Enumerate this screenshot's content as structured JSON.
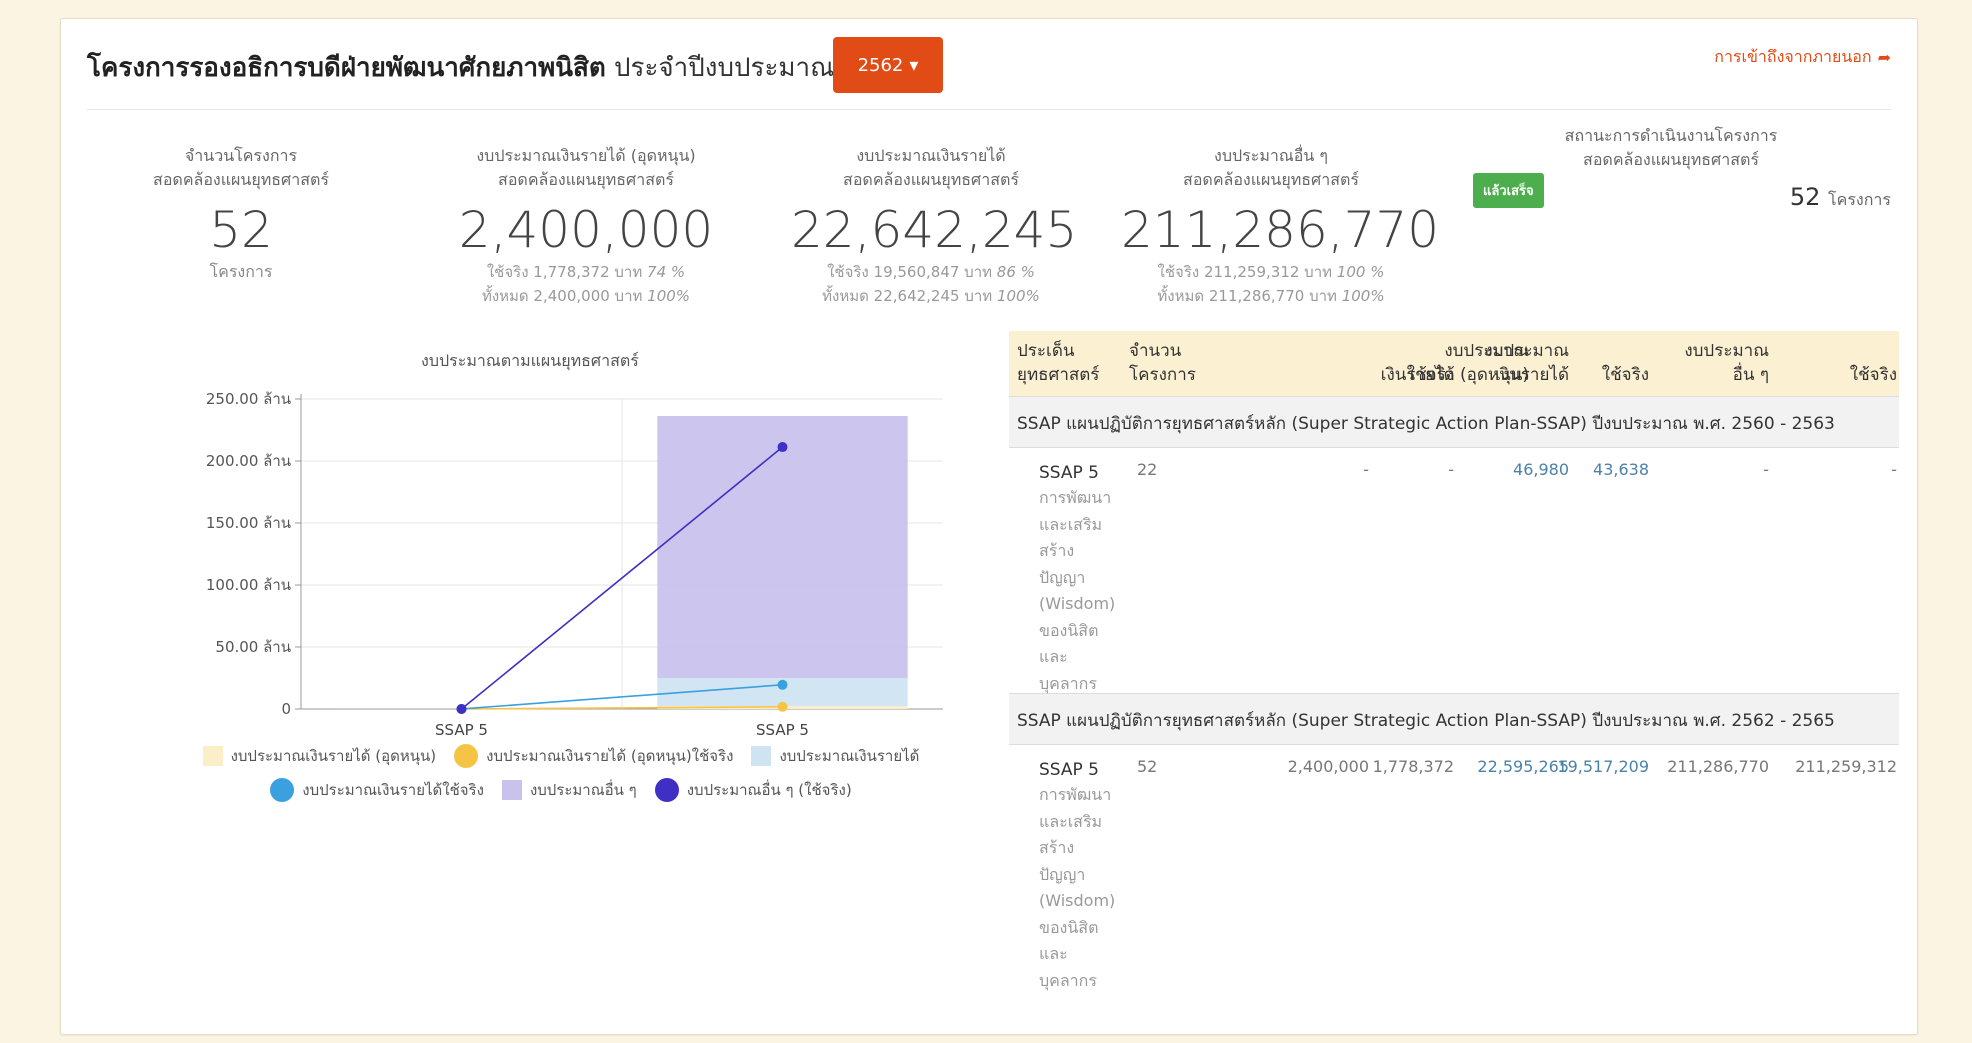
{
  "header": {
    "title_bold": "โครงการรองอธิการบดีฝ่ายพัฒนาศักยภาพนิสิต",
    "title_rest": "ประจำปีงบประมาณ",
    "year": "2562",
    "external_link": "การเข้าถึงจากภายนอก"
  },
  "stats": {
    "projects": {
      "label1": "จำนวนโครงการ",
      "label2": "สอดคล้องแผนยุทธศาสตร์",
      "value": "52",
      "unit": "โครงการ"
    },
    "subsidy": {
      "label1": "งบประมาณเงินรายได้ (อุดหนุน)",
      "label2": "สอดคล้องแผนยุทธศาสตร์",
      "value": "2,400,000",
      "used": "ใช้จริง 1,778,372 บาท",
      "used_pct": "74 %",
      "total": "ทั้งหมด 2,400,000 บาท",
      "total_pct": "100%"
    },
    "income": {
      "label1": "งบประมาณเงินรายได้",
      "label2": "สอดคล้องแผนยุทธศาสตร์",
      "value": "22,642,245",
      "used": "ใช้จริง 19,560,847 บาท",
      "used_pct": "86 %",
      "total": "ทั้งหมด 22,642,245 บาท",
      "total_pct": "100%"
    },
    "other": {
      "label1": "งบประมาณอื่น ๆ",
      "label2": "สอดคล้องแผนยุทธศาสตร์",
      "value": "211,286,770",
      "used": "ใช้จริง 211,259,312 บาท",
      "used_pct": "100 %",
      "total": "ทั้งหมด 211,286,770 บาท",
      "total_pct": "100%"
    },
    "status": {
      "label1": "สถานะการดำเนินงานโครงการ",
      "label2": "สอดคล้องแผนยุทธศาสตร์",
      "badge": "แล้วเสร็จ",
      "count": "52",
      "unit": "โครงการ"
    }
  },
  "chart_title": "งบประมาณตามแผนยุทธศาสตร์",
  "chart_data": {
    "type": "bar",
    "categories": [
      "SSAP 5",
      "SSAP 5"
    ],
    "ylim": [
      0,
      250000000
    ],
    "yticks": [
      0,
      50000000,
      100000000,
      150000000,
      200000000,
      250000000
    ],
    "ytick_labels": [
      "0",
      "50.00 ล้าน",
      "100.00 ล้าน",
      "150.00 ล้าน",
      "200.00 ล้าน",
      "250.00 ล้าน"
    ],
    "series": [
      {
        "name": "งบประมาณเงินรายได้ (อุดหนุน)",
        "kind": "bar",
        "color": "#fbeec9",
        "values": [
          0,
          2400000
        ]
      },
      {
        "name": "งบประมาณเงินรายได้ (อุดหนุน)ใช้จริง",
        "kind": "line",
        "color": "#f6c445",
        "values": [
          0,
          1778372
        ]
      },
      {
        "name": "งบประมาณเงินรายได้",
        "kind": "bar",
        "color": "#cfe4f1",
        "values": [
          46980,
          22595265
        ]
      },
      {
        "name": "งบประมาณเงินรายได้ใช้จริง",
        "kind": "line",
        "color": "#3aa0e0",
        "values": [
          43638,
          19517209
        ]
      },
      {
        "name": "งบประมาณอื่น ๆ",
        "kind": "bar",
        "color": "#c9c2ec",
        "values": [
          0,
          211286770
        ]
      },
      {
        "name": "งบประมาณอื่น ๆ (ใช้จริง)",
        "kind": "line",
        "color": "#3f2fc4",
        "values": [
          0,
          211259312
        ]
      }
    ]
  },
  "table": {
    "headers": [
      {
        "l1": "ประเด็น",
        "l2": "ยุทธศาสตร์"
      },
      {
        "l1": "จำนวน",
        "l2": "โครงการ"
      },
      {
        "l1": "งบประมาณ",
        "l2": "เงินรายได้ (อุดหนุน)"
      },
      {
        "l1": "",
        "l2": "ใช้จริง"
      },
      {
        "l1": "งบประมาณ",
        "l2": "เงินรายได้"
      },
      {
        "l1": "",
        "l2": "ใช้จริง"
      },
      {
        "l1": "งบประมาณ",
        "l2": "อื่น ๆ"
      },
      {
        "l1": "",
        "l2": "ใช้จริง"
      }
    ],
    "groups": [
      {
        "title": "SSAP แผนปฏิบัติการยุทธศาสตร์หลัก (Super Strategic Action Plan-SSAP) ปีงบประมาณ พ.ศ. 2560 - 2563",
        "row": {
          "code": "SSAP 5",
          "desc": [
            "การพัฒนา",
            "และเสริม",
            "สร้าง",
            "ปัญญา",
            "(Wisdom)",
            "ของนิสิต",
            "และ",
            "บุคลากร"
          ],
          "count": "22",
          "subsidy": "-",
          "subsidy_used": "-",
          "income": "46,980",
          "income_used": "43,638",
          "other": "-",
          "other_used": "-"
        }
      },
      {
        "title": "SSAP แผนปฏิบัติการยุทธศาสตร์หลัก (Super Strategic Action Plan-SSAP) ปีงบประมาณ พ.ศ. 2562 - 2565",
        "row": {
          "code": "SSAP 5",
          "desc": [
            "การพัฒนา",
            "และเสริม",
            "สร้าง",
            "ปัญญา",
            "(Wisdom)",
            "ของนิสิต",
            "และ",
            "บุคลากร"
          ],
          "count": "52",
          "subsidy": "2,400,000",
          "subsidy_used": "1,778,372",
          "income": "22,595,265",
          "income_used": "19,517,209",
          "other": "211,286,770",
          "other_used": "211,259,312"
        }
      }
    ]
  }
}
